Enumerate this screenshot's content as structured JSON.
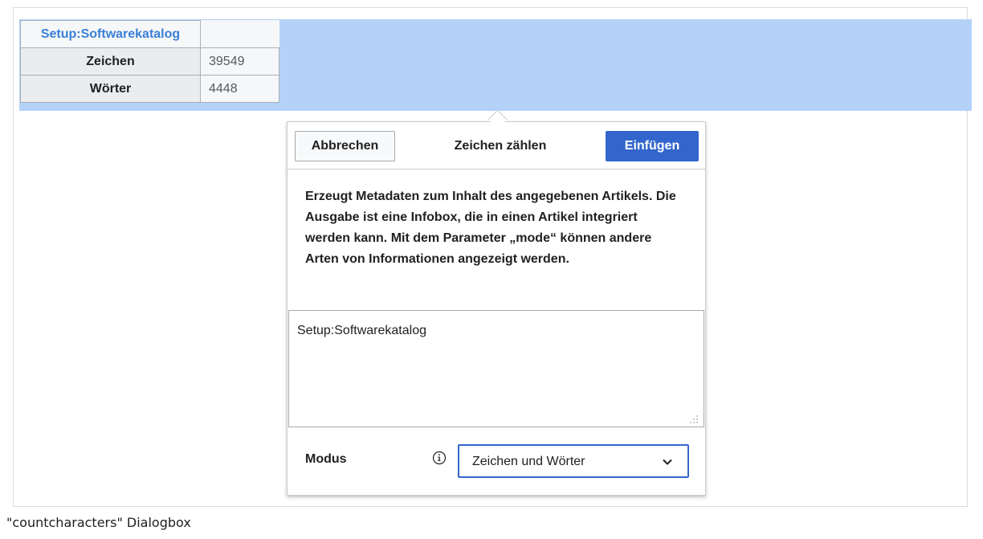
{
  "infobox": {
    "title": "Setup:Softwarekatalog",
    "rows": [
      {
        "label": "Zeichen",
        "value": "39549"
      },
      {
        "label": "Wörter",
        "value": "4448"
      }
    ]
  },
  "dialog": {
    "cancel_label": "Abbrechen",
    "title": "Zeichen zählen",
    "insert_label": "Einfügen",
    "description": "Erzeugt Metadaten zum Inhalt des angegebenen Artikels. Die Ausgabe ist eine Infobox, die in einen Artikel integriert werden kann. Mit dem Parameter „mode“ können andere Arten von Informationen angezeigt werden.",
    "input_value": "Setup:Softwarekatalog",
    "mode_label": "Modus",
    "mode_selected": "Zeichen und Wörter"
  },
  "caption": "\"countcharacters\" Dialogbox",
  "colors": {
    "selection": "#b4d2f8",
    "accent": "#3366cc",
    "infobox_title": "#3a7fd6"
  },
  "icons": {
    "info": "info-icon",
    "dropdown": "chevron-down-icon",
    "grip": "resize-grip-icon"
  }
}
